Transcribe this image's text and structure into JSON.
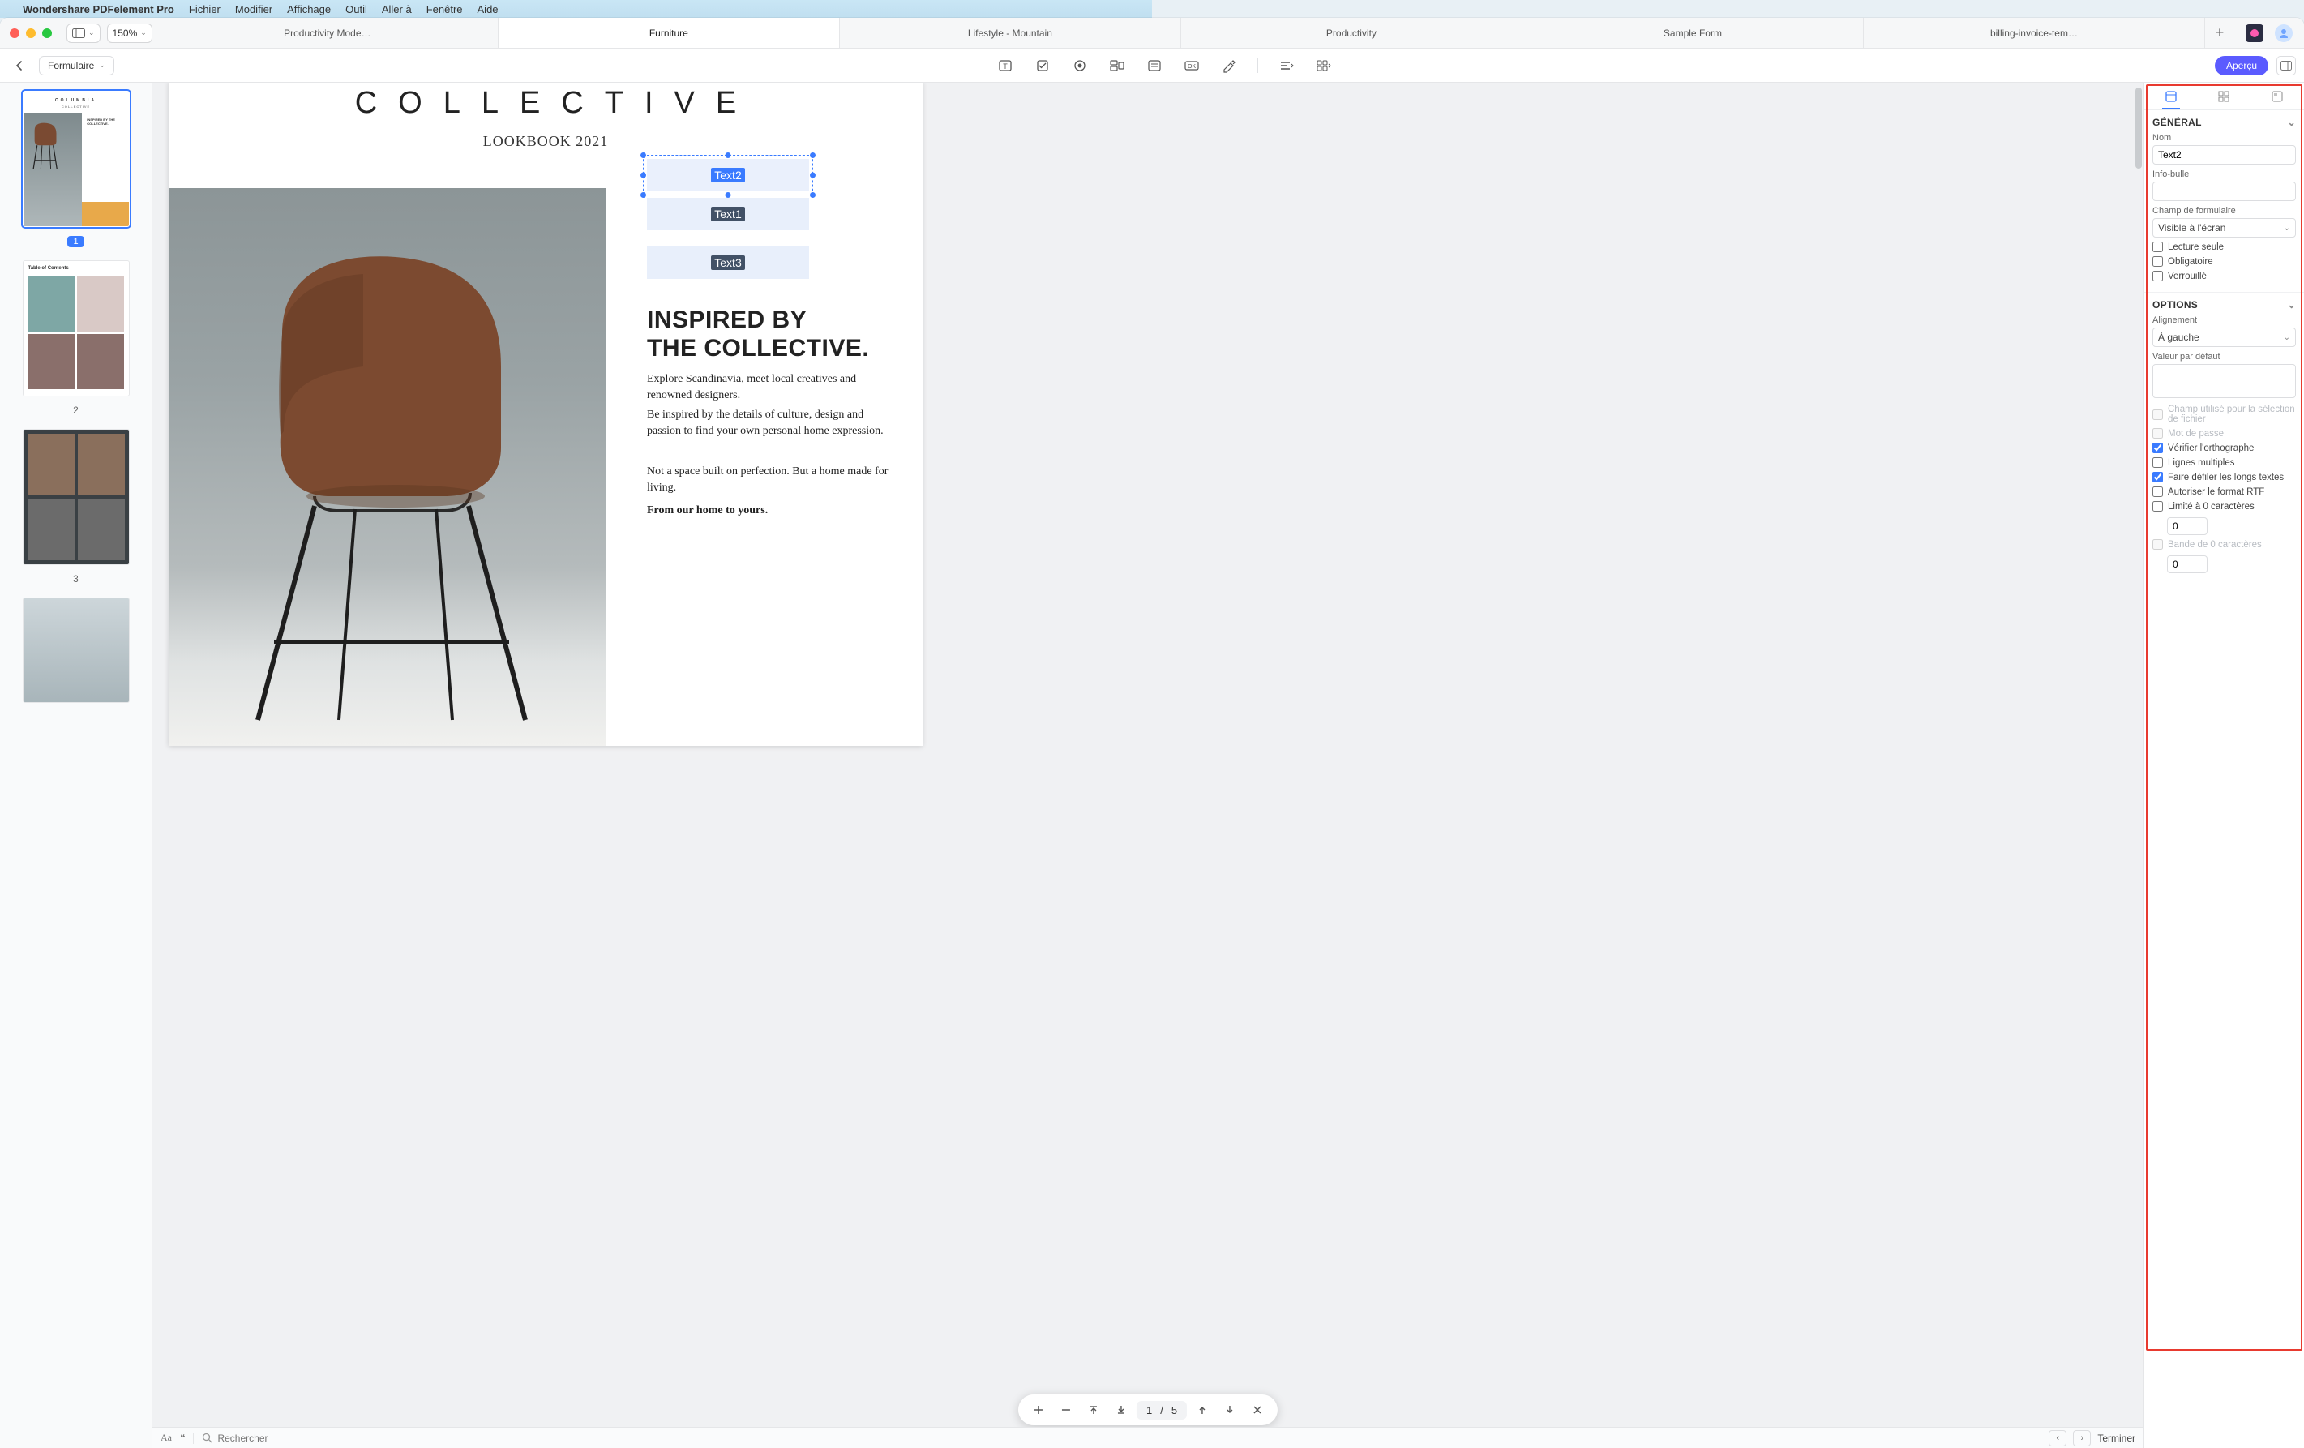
{
  "menubar": {
    "app_name": "Wondershare PDFelement Pro",
    "items": [
      "Fichier",
      "Modifier",
      "Affichage",
      "Outil",
      "Aller à",
      "Fenêtre",
      "Aide"
    ]
  },
  "titlebar": {
    "zoom": "150%",
    "tabs": [
      "Productivity Mode…",
      "Furniture",
      "Lifestyle - Mountain",
      "Productivity",
      "Sample Form",
      "billing-invoice-tem…"
    ],
    "active_tab_index": 1
  },
  "toolbar2": {
    "mode": "Formulaire",
    "preview": "Aperçu"
  },
  "thumbs": {
    "page_numbers": [
      "1",
      "2",
      "3"
    ],
    "t1": {
      "brand": "COLUMBIA",
      "sub": "COLLECTIVE",
      "tag": "INSPIRED BY THE COLLECTIVE."
    },
    "t2": {
      "title": "Table of Contents"
    }
  },
  "page": {
    "title": "COLLECTIVE",
    "subtitle": "LOOKBOOK 2021",
    "fields": {
      "f1": "Text2",
      "f2": "Text1",
      "f3": "Text3"
    },
    "heading_l1": "INSPIRED BY",
    "heading_l2": "THE COLLECTIVE.",
    "para1": "Explore Scandinavia, meet local creatives and renowned designers.",
    "para2": "Be inspired by the details of culture, design and passion to find your own personal home expression.",
    "para3": "Not a space built on perfection. But a home made for living.",
    "tagline": "From our home to yours."
  },
  "pagenav": {
    "current": "1",
    "sep": "/",
    "total": "5"
  },
  "statusbar": {
    "aa": "Aa",
    "quote": "❝",
    "search_placeholder": "Rechercher",
    "finish": "Terminer"
  },
  "props": {
    "general": {
      "title": "GÉNÉRAL",
      "name_label": "Nom",
      "name_value": "Text2",
      "tooltip_label": "Info-bulle",
      "tooltip_value": "",
      "formfield_label": "Champ de formulaire",
      "formfield_value": "Visible à l'écran",
      "readonly": "Lecture seule",
      "required": "Obligatoire",
      "locked": "Verrouillé"
    },
    "options": {
      "title": "OPTIONS",
      "align_label": "Alignement",
      "align_value": "À gauche",
      "default_label": "Valeur par défaut",
      "default_value": "",
      "file_sel": "Champ utilisé pour la sélection de fichier",
      "password": "Mot de passe",
      "spellcheck": "Vérifier l'orthographe",
      "multiline": "Lignes multiples",
      "scroll": "Faire défiler les longs textes",
      "rtf": "Autoriser le format RTF",
      "limit_chars": "Limité à 0 caractères",
      "limit_val": "0",
      "comb": "Bande de 0 caractères",
      "comb_val": "0"
    }
  }
}
